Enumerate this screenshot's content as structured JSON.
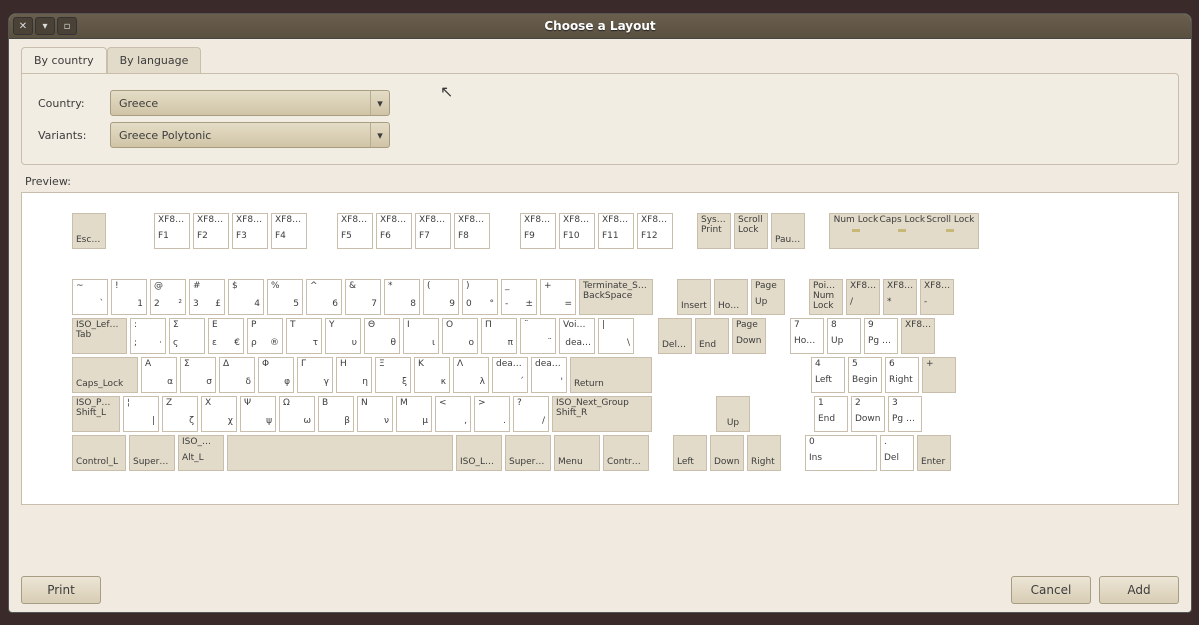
{
  "window": {
    "title": "Choose a Layout"
  },
  "tabs": {
    "country": "By country",
    "language": "By language"
  },
  "form": {
    "country_label": "Country:",
    "country_value": "Greece",
    "variants_label": "Variants:",
    "variants_value": "Greece Polytonic"
  },
  "preview_label": "Preview:",
  "buttons": {
    "print": "Print",
    "cancel": "Cancel",
    "add": "Add"
  },
  "keys": {
    "esc": "Esc…",
    "fkeys": [
      {
        "t": "XF8…",
        "b": "F1"
      },
      {
        "t": "XF8…",
        "b": "F2"
      },
      {
        "t": "XF8…",
        "b": "F3"
      },
      {
        "t": "XF8…",
        "b": "F4"
      },
      {
        "t": "XF8…",
        "b": "F5"
      },
      {
        "t": "XF8…",
        "b": "F6"
      },
      {
        "t": "XF8…",
        "b": "F7"
      },
      {
        "t": "XF8…",
        "b": "F8"
      },
      {
        "t": "XF8…",
        "b": "F9"
      },
      {
        "t": "XF8…",
        "b": "F10"
      },
      {
        "t": "XF8…",
        "b": "F11"
      },
      {
        "t": "XF8…",
        "b": "F12"
      }
    ],
    "sys": {
      "t": "Sys…",
      "b": "Print"
    },
    "scroll": {
      "t": "Scroll",
      "b": "Lock"
    },
    "pause": "Pau…",
    "leds": {
      "num": "Num Lock",
      "caps": "Caps Lock",
      "scroll": "Scroll Lock"
    },
    "row1": [
      {
        "tl": "~",
        "br": "`"
      },
      {
        "tl": "!",
        "br": "1"
      },
      {
        "tl": "@",
        "bl": "2",
        "br": "²"
      },
      {
        "tl": "#",
        "bl": "3",
        "br": "£"
      },
      {
        "tl": "$",
        "br": "4"
      },
      {
        "tl": "%",
        "br": "5"
      },
      {
        "tl": "^",
        "br": "6"
      },
      {
        "tl": "&",
        "br": "7"
      },
      {
        "tl": "*",
        "br": "8"
      },
      {
        "tl": "(",
        "br": "9"
      },
      {
        "tl": ")",
        "bl": "0",
        "br": "°"
      },
      {
        "tl": "_",
        "bl": "-",
        "br": "±"
      },
      {
        "tl": "+",
        "br": "="
      }
    ],
    "backspace": {
      "t": "Terminate_S…",
      "b": "BackSpace"
    },
    "tab": {
      "t": "ISO_Lef…",
      "b": "Tab"
    },
    "row2": [
      {
        "tl": ":",
        "bl": ";",
        "br": "·"
      },
      {
        "tl": "Σ",
        "bl": "ς"
      },
      {
        "tl": "Ε",
        "bl": "ε",
        "br": "€"
      },
      {
        "tl": "Ρ",
        "bl": "ρ",
        "br": "®"
      },
      {
        "tl": "Τ",
        "br": "τ"
      },
      {
        "tl": "Υ",
        "br": "υ"
      },
      {
        "tl": "Θ",
        "br": "θ"
      },
      {
        "tl": "Ι",
        "br": "ι"
      },
      {
        "tl": "Ο",
        "br": "ο"
      },
      {
        "tl": "Π",
        "br": "π"
      },
      {
        "tl": "¨",
        "br": "¨"
      },
      {
        "tl": "Voi…",
        "br": "dea…"
      },
      {
        "tl": "|",
        "br": "\\"
      }
    ],
    "caps": "Caps_Lock",
    "row3": [
      {
        "tl": "Α",
        "br": "α"
      },
      {
        "tl": "Σ",
        "br": "σ"
      },
      {
        "tl": "Δ",
        "br": "δ"
      },
      {
        "tl": "Φ",
        "br": "φ"
      },
      {
        "tl": "Γ",
        "br": "γ"
      },
      {
        "tl": "Η",
        "br": "η"
      },
      {
        "tl": "Ξ",
        "br": "ξ"
      },
      {
        "tl": "Κ",
        "br": "κ"
      },
      {
        "tl": "Λ",
        "br": "λ"
      },
      {
        "tl": "dea…",
        "br": "΄"
      },
      {
        "tl": "dea…",
        "br": "'"
      }
    ],
    "return": "Return",
    "shiftl": {
      "t": "ISO_P…",
      "b": "Shift_L"
    },
    "row4": [
      {
        "tl": "¦",
        "br": "|"
      },
      {
        "tl": "Ζ",
        "br": "ζ"
      },
      {
        "tl": "Χ",
        "br": "χ"
      },
      {
        "tl": "Ψ",
        "br": "ψ"
      },
      {
        "tl": "Ω",
        "br": "ω"
      },
      {
        "tl": "Β",
        "br": "β"
      },
      {
        "tl": "Ν",
        "br": "ν"
      },
      {
        "tl": "Μ",
        "br": "μ"
      },
      {
        "tl": "<",
        "br": ","
      },
      {
        "tl": ">",
        "br": "."
      },
      {
        "tl": "?",
        "br": "/"
      }
    ],
    "shiftr": {
      "t": "ISO_Next_Group",
      "b": "Shift_R"
    },
    "row5": [
      "Control_L",
      "Super…",
      {
        "t": "ISO_…",
        "b": "Alt_L"
      },
      "",
      "ISO_L…",
      "Super…",
      "Menu",
      "Contr…"
    ],
    "nav1": [
      "Insert",
      "Ho…",
      {
        "t": "Page",
        "b": "Up"
      }
    ],
    "nav2": [
      "Del…",
      "End",
      {
        "t": "Page",
        "b": "Down"
      }
    ],
    "arrows": {
      "up": "Up",
      "left": "Left",
      "down": "Down",
      "right": "Right"
    },
    "numtop": [
      {
        "t": "Poi…",
        "m": "Num",
        "b": "Lock"
      },
      {
        "t": "XF8…",
        "b": "/"
      },
      {
        "t": "XF8…",
        "b": "*"
      },
      {
        "t": "XF8…",
        "b": "-"
      }
    ],
    "num1": [
      {
        "t": "7",
        "b": "Ho…"
      },
      {
        "t": "8",
        "b": "Up"
      },
      {
        "t": "9",
        "b": "Pg …"
      },
      {
        "t": "XF8…",
        "b": ""
      }
    ],
    "num2": [
      {
        "t": "4",
        "b": "Left"
      },
      {
        "t": "5",
        "b": "Begin"
      },
      {
        "t": "6",
        "b": "Right"
      },
      {
        "t": "+",
        "b": ""
      }
    ],
    "num3": [
      {
        "t": "1",
        "b": "End"
      },
      {
        "t": "2",
        "b": "Down"
      },
      {
        "t": "3",
        "b": "Pg …"
      }
    ],
    "num4": [
      {
        "t": "0",
        "b": "Ins"
      },
      {
        "t": ".",
        "b": "Del"
      },
      "Enter"
    ]
  }
}
